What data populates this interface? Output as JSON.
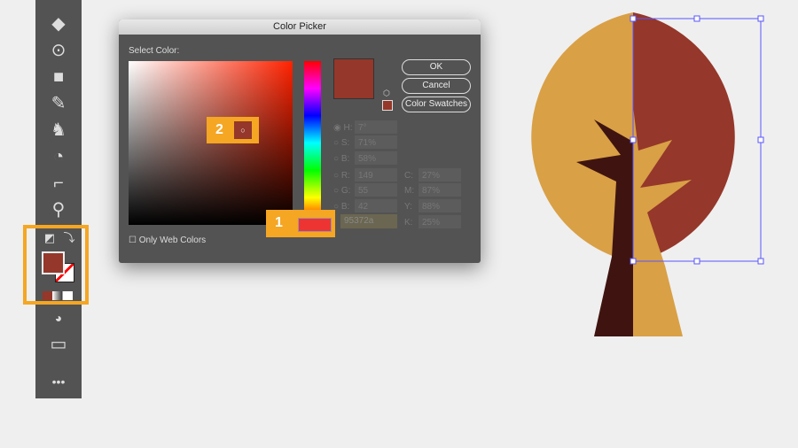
{
  "dialog": {
    "title": "Color Picker",
    "select_label": "Select Color:",
    "ok": "OK",
    "cancel": "Cancel",
    "swatches": "Color Swatches",
    "web_only": "Only Web Colors",
    "hex": "95372a"
  },
  "fields": [
    {
      "l": "H:",
      "v": "7°"
    },
    {
      "l": "S:",
      "v": "71%"
    },
    {
      "l": "B:",
      "v": "58%"
    },
    {
      "l": "R:",
      "v": "149"
    },
    {
      "l": "G:",
      "v": "55"
    },
    {
      "l": "B:",
      "v": "42"
    }
  ],
  "cmyk": [
    {
      "l": "C:",
      "v": "27%"
    },
    {
      "l": "M:",
      "v": "87%"
    },
    {
      "l": "Y:",
      "v": "88%"
    },
    {
      "l": "K:",
      "v": "25%"
    }
  ],
  "callouts": [
    "1",
    "2"
  ],
  "colors": {
    "selected": "#95372a",
    "tan": "#d9a046",
    "dark": "#3f1410",
    "accent": "#f5a623"
  }
}
